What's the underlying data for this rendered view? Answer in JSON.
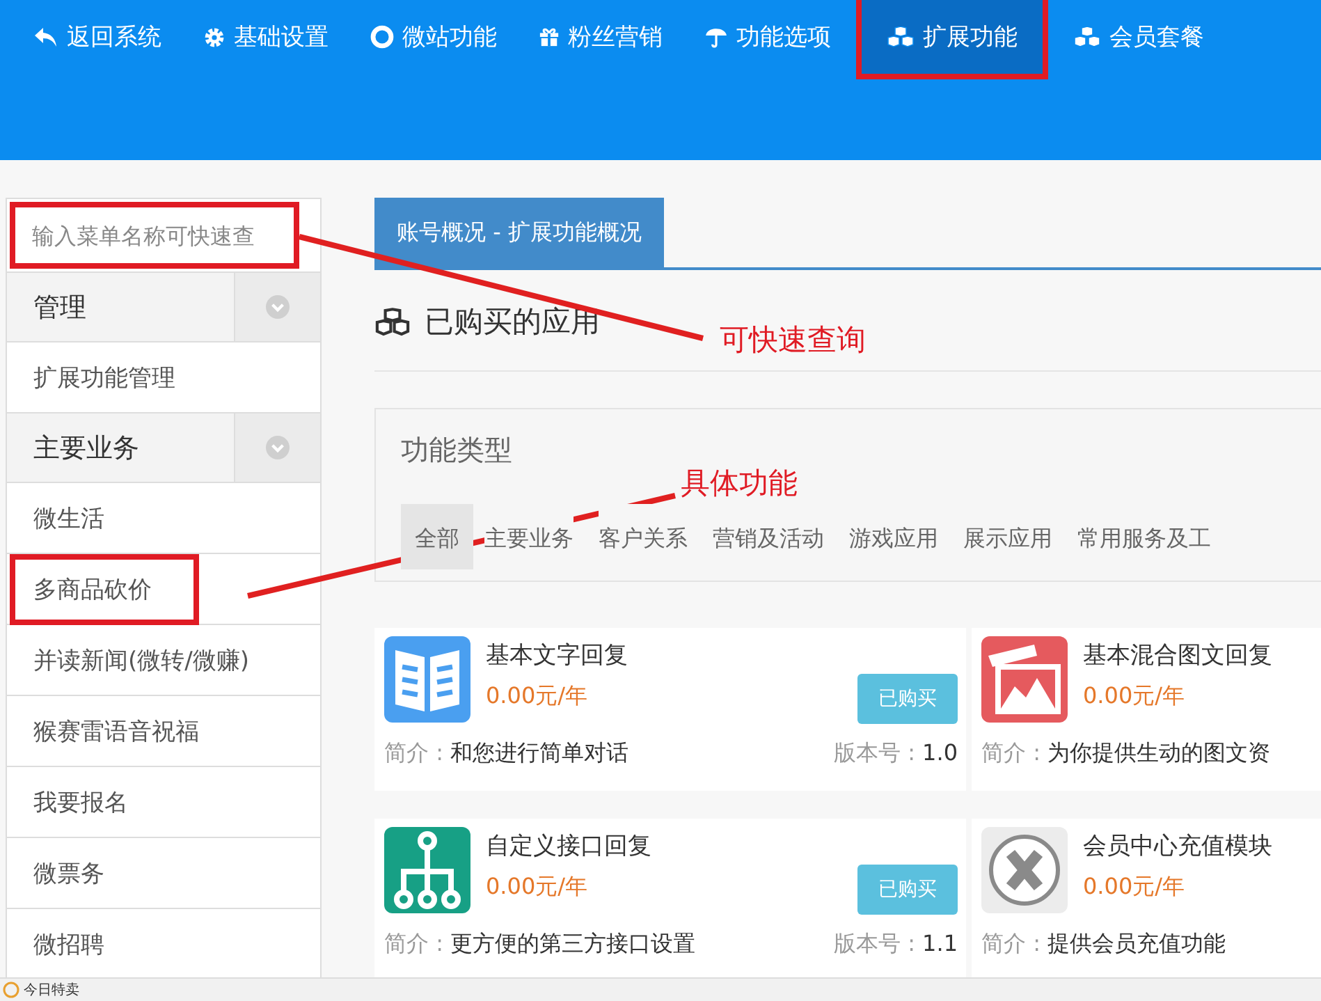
{
  "nav": [
    {
      "label": "返回系统",
      "kind": "reply",
      "selected": false,
      "highlighted": false
    },
    {
      "label": "基础设置",
      "kind": "gear",
      "selected": false,
      "highlighted": false
    },
    {
      "label": "微站功能",
      "kind": "ring",
      "selected": false,
      "highlighted": false
    },
    {
      "label": "粉丝营销",
      "kind": "gift",
      "selected": false,
      "highlighted": false
    },
    {
      "label": "功能选项",
      "kind": "umbrella",
      "selected": false,
      "highlighted": false
    },
    {
      "label": "扩展功能",
      "kind": "cubes",
      "selected": true,
      "highlighted": true
    },
    {
      "label": "会员套餐",
      "kind": "cubes",
      "selected": false,
      "highlighted": false
    }
  ],
  "sidebar": {
    "search": {
      "placeholder": "输入菜单名称可快速查",
      "highlighted": true
    },
    "items": [
      {
        "kind": "group",
        "label": "管理",
        "highlighted": false
      },
      {
        "kind": "link",
        "label": "扩展功能管理",
        "highlighted": false
      },
      {
        "kind": "group",
        "label": "主要业务",
        "highlighted": false
      },
      {
        "kind": "link",
        "label": "微生活",
        "highlighted": false
      },
      {
        "kind": "link",
        "label": "多商品砍价",
        "highlighted": true
      },
      {
        "kind": "link",
        "label": "并读新闻(微转/微赚)",
        "highlighted": false
      },
      {
        "kind": "link",
        "label": "猴赛雷语音祝福",
        "highlighted": false
      },
      {
        "kind": "link",
        "label": "我要报名",
        "highlighted": false
      },
      {
        "kind": "link",
        "label": "微票务",
        "highlighted": false
      },
      {
        "kind": "link",
        "label": "微招聘",
        "highlighted": false
      }
    ]
  },
  "page_tab": "账号概况 - 扩展功能概况",
  "section_title": "已购买的应用",
  "filter": {
    "title": "功能类型",
    "options": [
      {
        "label": "全部",
        "selected": true
      },
      {
        "label": "主要业务",
        "selected": false
      },
      {
        "label": "客户关系",
        "selected": false
      },
      {
        "label": "营销及活动",
        "selected": false
      },
      {
        "label": "游戏应用",
        "selected": false
      },
      {
        "label": "展示应用",
        "selected": false
      },
      {
        "label": "常用服务及工",
        "selected": false
      }
    ]
  },
  "apps": [
    {
      "name": "基本文字回复",
      "kind": "book",
      "price": "0.00元/年",
      "button": "已购买",
      "desc_label": "简介 :",
      "desc": "和您进行简单对话",
      "version_label": "版本号 :",
      "version": "1.0"
    },
    {
      "name": "基本混合图文回复",
      "kind": "photo",
      "price": "0.00元/年",
      "desc_label": "简介 :",
      "desc": "为你提供生动的图文资"
    },
    {
      "name": "自定义接口回复",
      "kind": "tree",
      "price": "0.00元/年",
      "button": "已购买",
      "desc_label": "简介 :",
      "desc": "更方便的第三方接口设置",
      "version_label": "版本号 :",
      "version": "1.1"
    },
    {
      "name": "会员中心充值模块",
      "kind": "xcircle",
      "price": "0.00元/年",
      "desc_label": "简介 :",
      "desc": "提供会员充值功能"
    }
  ],
  "footer": {
    "label": "今日特卖"
  },
  "annotations": [
    {
      "label": "可快速查询"
    },
    {
      "label": "具体功能"
    }
  ]
}
